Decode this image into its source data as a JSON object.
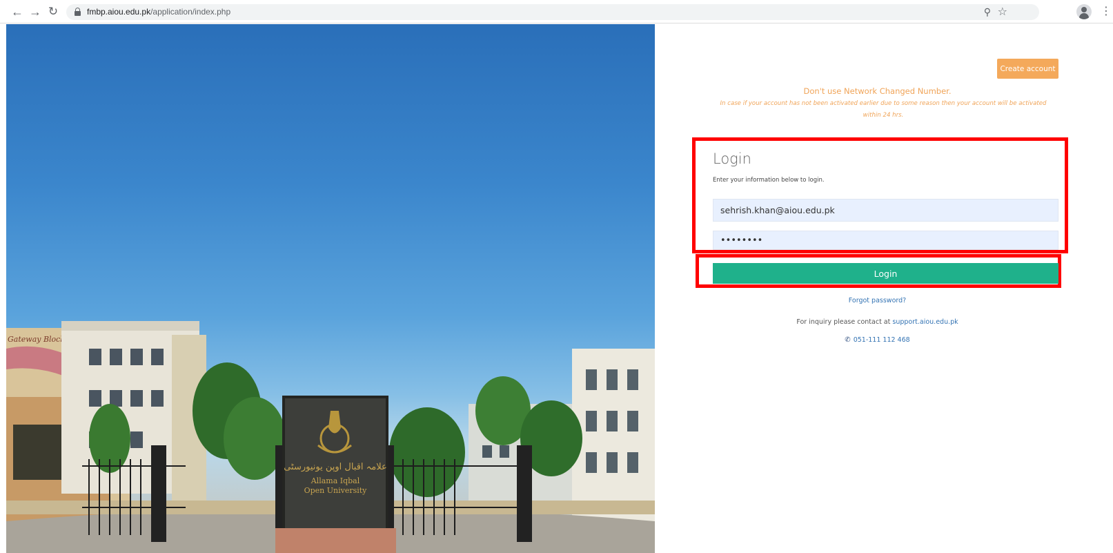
{
  "browser": {
    "url_host": "fmbp.aiou.edu.pk",
    "url_path": "/application/index.php",
    "icons": [
      "back-arrow-icon",
      "forward-arrow-icon",
      "reload-icon",
      "lock-icon",
      "key-icon",
      "star-icon",
      "profile-icon",
      "menu-icon"
    ]
  },
  "image": {
    "sign_urdu": "علامہ اقبال اوپن یونیورسٹی",
    "sign_english_1": "Allama Iqbal",
    "sign_english_2": "Open University",
    "building_sign": "Gateway Block"
  },
  "header": {
    "create_account_label": "Create account"
  },
  "notice": {
    "title": "Don't use Network Changed Number.",
    "body": "In case if your account has not been activated earlier due to some reason then your account will be activated within 24 hrs."
  },
  "login": {
    "title": "Login",
    "subtitle": "Enter your information below to login.",
    "email_value": "sehrish.khan@aiou.edu.pk",
    "password_value": "••••••••",
    "button_label": "Login",
    "highlight_color": "#ff0000",
    "button_color": "#1fb18b"
  },
  "footer": {
    "forgot_label": "Forgot password?",
    "inquiry_text": "For inquiry please contact at ",
    "support_link": "support.aiou.edu.pk",
    "phone": "051-111 112 468"
  },
  "colors": {
    "accent_orange": "#f4a95b",
    "link_blue": "#3373b3"
  }
}
